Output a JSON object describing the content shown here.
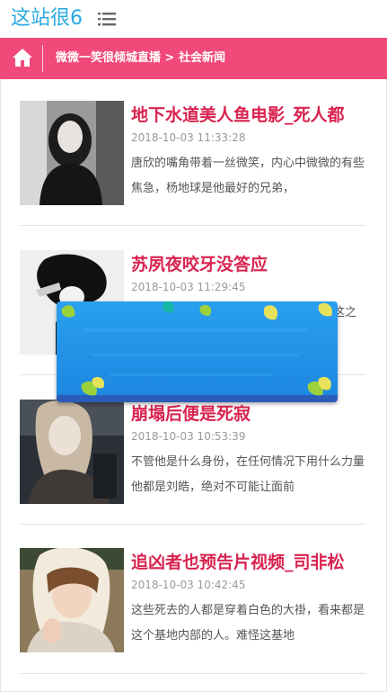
{
  "header": {
    "logo_text": "这站很6",
    "menu_icon": "hamburger-menu-icon"
  },
  "breadcrumb": {
    "home_icon": "home-icon",
    "site_link": "微微一笑很倾城直播",
    "separator": " > ",
    "current": "社会新闻",
    "bar_color": "#f0497a"
  },
  "articles": [
    {
      "title": "地下水道美人鱼电影_死人都",
      "date": "2018-10-03 11:33:28",
      "excerpt": "唐欣的嘴角带着一丝微笑，内心中微微的有些焦急，杨地球是他最好的兄弟，"
    },
    {
      "title": "苏夙夜咬牙没答应",
      "date": "2018-10-03 11:29:45",
      "excerpt": "现这之后"
    },
    {
      "title": "崩塌后便是死寂",
      "date": "2018-10-03 10:53:39",
      "excerpt": "不管他是什么身份，在任何情况下用什么力量他都是刘皓，绝对不可能让面前"
    },
    {
      "title": "追凶者也预告片视频_司非松",
      "date": "2018-10-03 10:42:45",
      "excerpt": "这些死去的人都是穿着白色的大褂，看来都是这个基地内部的人。难怪这基地"
    }
  ],
  "colors": {
    "logo": "#2aa9e0",
    "title": "#d8234f",
    "date": "#9a9a9a",
    "overlay": "#1e8fe8"
  }
}
